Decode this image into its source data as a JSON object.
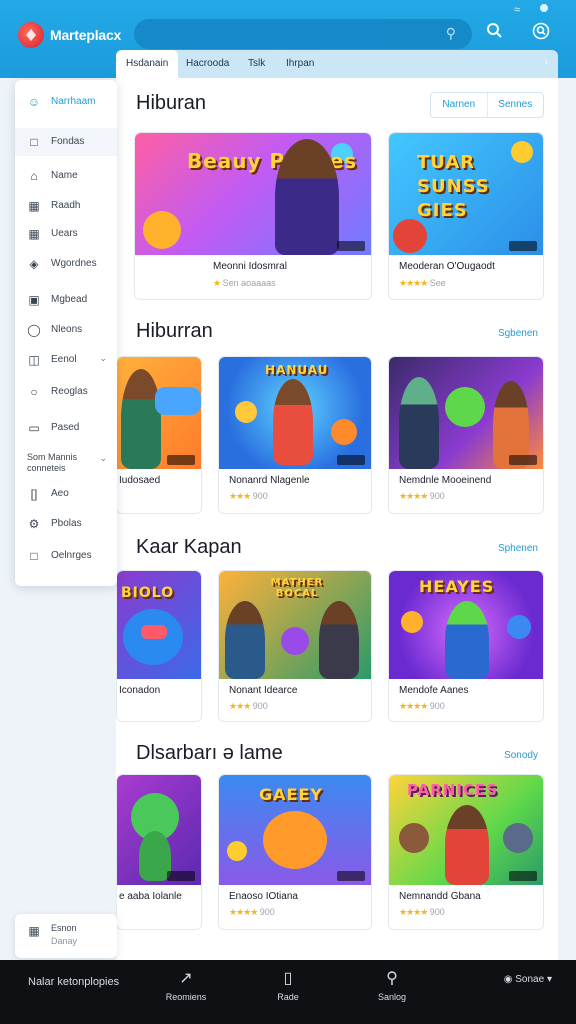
{
  "app": {
    "name": "Marteplacx"
  },
  "tabs": [
    "Hsdanain",
    "Hacrooda",
    "Tslk",
    "Ihrpan"
  ],
  "sidebar": {
    "header": "Narrhaam",
    "items": [
      {
        "label": "Fondas",
        "icon": "square-icon"
      },
      {
        "label": "Name",
        "icon": "home-icon"
      },
      {
        "label": "Raadh",
        "icon": "grid-icon"
      },
      {
        "label": "Uears",
        "icon": "grid-icon"
      },
      {
        "label": "Wgordnes",
        "icon": "tag-icon"
      },
      {
        "label": "Mgbead",
        "icon": "lock-icon"
      },
      {
        "label": "Nleons",
        "icon": "globe-icon"
      },
      {
        "label": "Eenol",
        "icon": "box-icon"
      },
      {
        "label": "Reoglas",
        "icon": "chat-icon"
      },
      {
        "label": "Pased",
        "icon": "doc-icon"
      },
      {
        "label": "Som Mannis conneteis",
        "icon": ""
      },
      {
        "label": "Aeo",
        "icon": "bracket-icon"
      },
      {
        "label": "Pbolas",
        "icon": "gear-icon"
      },
      {
        "label": "Oelnrges",
        "icon": "square-icon"
      }
    ],
    "footer": {
      "line1": "Esnon",
      "line2": "Danay"
    }
  },
  "header_pills": [
    "Narnen",
    "Sennes"
  ],
  "sections": [
    {
      "title": "Hiburan",
      "cards": [
        {
          "title": "Meonni Idosmral",
          "rating_text": "Sen aoaaaas",
          "stars": "★",
          "art_text": "Beauy Paques",
          "theme": "pink"
        },
        {
          "title": "Meoderan O'Ougaodt",
          "rating_text": "See",
          "stars": "★★★★",
          "art_text": "TUAR SUNSS GIES",
          "theme": "blue"
        }
      ]
    },
    {
      "title": "Hiburran",
      "link": "Sgbenen",
      "cards": [
        {
          "title": "Iudosaed",
          "rating_text": "",
          "stars": "",
          "art_text": "",
          "theme": "orange"
        },
        {
          "title": "Nonanrd Nlagenle",
          "rating_text": "900",
          "stars": "★★★",
          "art_text": "HANUAU",
          "theme": "sky"
        },
        {
          "title": "Nemdnle Mooeinend",
          "rating_text": "900",
          "stars": "★★★★",
          "art_text": "",
          "theme": "dark"
        }
      ]
    },
    {
      "title": "Kaar Kapan",
      "link": "Sphenen",
      "cards": [
        {
          "title": "Iconadon",
          "rating_text": "",
          "stars": "",
          "art_text": "BIOLO",
          "theme": "purple"
        },
        {
          "title": "Nonant Idearce",
          "rating_text": "900",
          "stars": "★★★",
          "art_text": "MATHER BOCAL",
          "theme": "green"
        },
        {
          "title": "Mendofe Aanes",
          "rating_text": "900",
          "stars": "★★★★",
          "art_text": "HEAYES",
          "theme": "violet"
        }
      ]
    },
    {
      "title": "Dlsarbarı ə lame",
      "link": "Sonody",
      "cards": [
        {
          "title": "e aaba Iolanle",
          "rating_text": "",
          "stars": "",
          "art_text": "",
          "theme": "purple"
        },
        {
          "title": "Enaoso IOtiana",
          "rating_text": "900",
          "stars": "★★★★",
          "art_text": "GAEEY",
          "theme": "blue"
        },
        {
          "title": "Nemnandd Gbana",
          "rating_text": "900",
          "stars": "★★★★",
          "art_text": "PARNICES",
          "theme": "yellow"
        }
      ]
    }
  ],
  "bottom_bar": {
    "left": "Nalar ketonplopies",
    "items": [
      {
        "label": "Reomiens",
        "icon": "share-icon"
      },
      {
        "label": "Rade",
        "icon": "doc-icon"
      },
      {
        "label": "Sanlog",
        "icon": "search-icon"
      }
    ],
    "right": "Sonae"
  },
  "colors": {
    "accent": "#1f9cd6",
    "topbar": "#22a9e6",
    "bottombar": "#0f1014"
  }
}
